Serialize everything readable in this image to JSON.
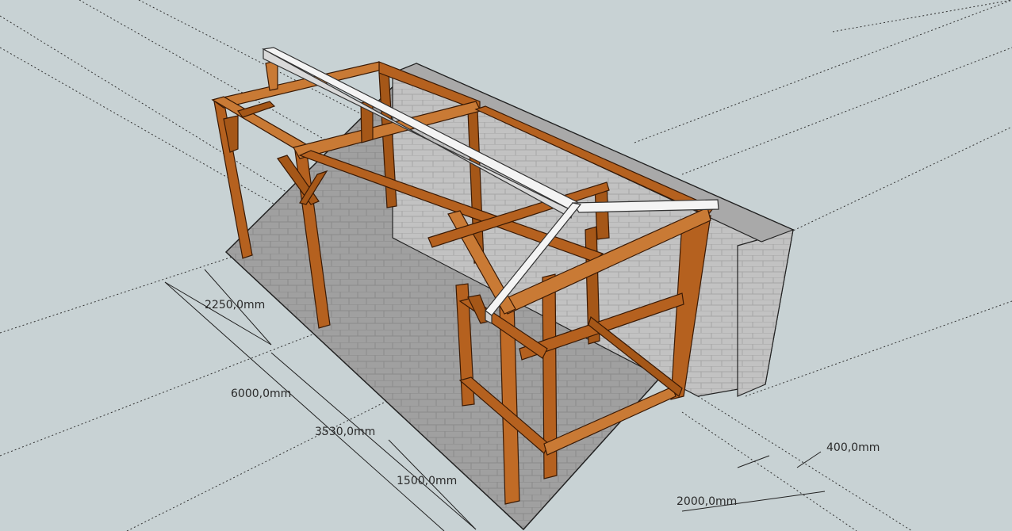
{
  "colors": {
    "background": "#c8d2d4",
    "timber": "#b5611f",
    "timber_dark": "#7a3c10",
    "timber_light": "#c97a35",
    "ridge_beam": "#f2f2f2",
    "wall": "#bfbfbf",
    "floor": "#9a9a9a",
    "line": "#1a1a1a"
  },
  "dimensions": {
    "d2250": "2250,0mm",
    "d6000": "6000,0mm",
    "d3530": "3530,0mm",
    "d1500": "1500,0mm",
    "d2000": "2000,0mm",
    "d400": "400,0mm"
  }
}
